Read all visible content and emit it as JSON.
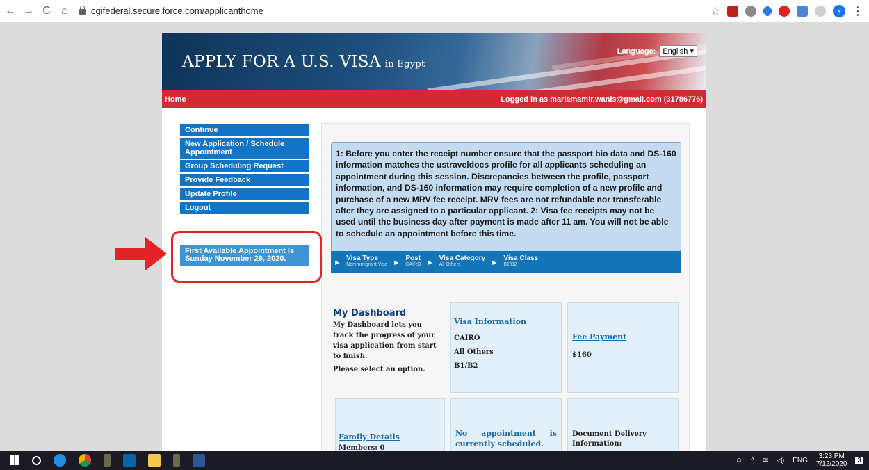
{
  "browser": {
    "back": "←",
    "forward": "→",
    "reload": "C",
    "home": "⌂",
    "url": "cgifederal.secure.force.com/applicanthome",
    "profile_initial": "k"
  },
  "banner": {
    "title": "APPLY FOR A U.S. VISA",
    "subtitle": "in Egypt",
    "language_label": "Language:",
    "language_value": "English ▾"
  },
  "topbar": {
    "home": "Home",
    "logged_in": "Logged in as  mariamamir.wanis@gmail.com (31786776)"
  },
  "sidebar": {
    "items": [
      {
        "label": "Continue"
      },
      {
        "label": "New Application / Schedule Appointment"
      },
      {
        "label": "Group Scheduling Request"
      },
      {
        "label": "Provide Feedback"
      },
      {
        "label": "Update Profile"
      },
      {
        "label": "Logout"
      }
    ],
    "first_available": "First Available Appointment Is Sunday November 29, 2020."
  },
  "notice": {
    "text": "1: Before you enter the receipt number ensure that the passport bio data and DS-160 information matches the ustraveldocs profile for all applicants scheduling an appointment during this session. Discrepancies between the profile, passport information, and DS-160 information may require completion of a new profile and purchase of a new MRV fee receipt. MRV fees are not refundable nor transferable after they are assigned to a particular applicant. 2: Visa fee receipts may not be used until the business day after payment is made after 11 am. You will not be able to schedule an appointment before this time."
  },
  "steps": [
    {
      "title": "Visa Type",
      "value": "Nonimmigrant Visa"
    },
    {
      "title": "Post",
      "value": "CAIRO"
    },
    {
      "title": "Visa Category",
      "value": "All Others"
    },
    {
      "title": "Visa Class",
      "value": "B1/B2"
    }
  ],
  "dashboard": {
    "title": "My Dashboard",
    "description": "My Dashboard lets you track the progress of your visa application from start to finish.",
    "prompt": "Please select an option."
  },
  "cards": {
    "visa_info": {
      "title": "Visa Information",
      "post": "CAIRO",
      "category": "All Others",
      "class": "B1/B2"
    },
    "fee": {
      "title": "Fee Payment",
      "amount": "$160"
    },
    "family": {
      "title": "Family Details",
      "members": "Members: 0"
    },
    "appointment": {
      "text": "No appointment is currently scheduled."
    },
    "delivery": {
      "text": "Document Delivery Information:"
    }
  },
  "taskbar": {
    "lang": "ENG",
    "time": "3:23 PM",
    "date": "7/12/2020",
    "notifications": "3"
  },
  "colors": {
    "menu_blue": "#1174c5",
    "red_bar": "#d12a32",
    "annotation_red": "#e22424"
  }
}
